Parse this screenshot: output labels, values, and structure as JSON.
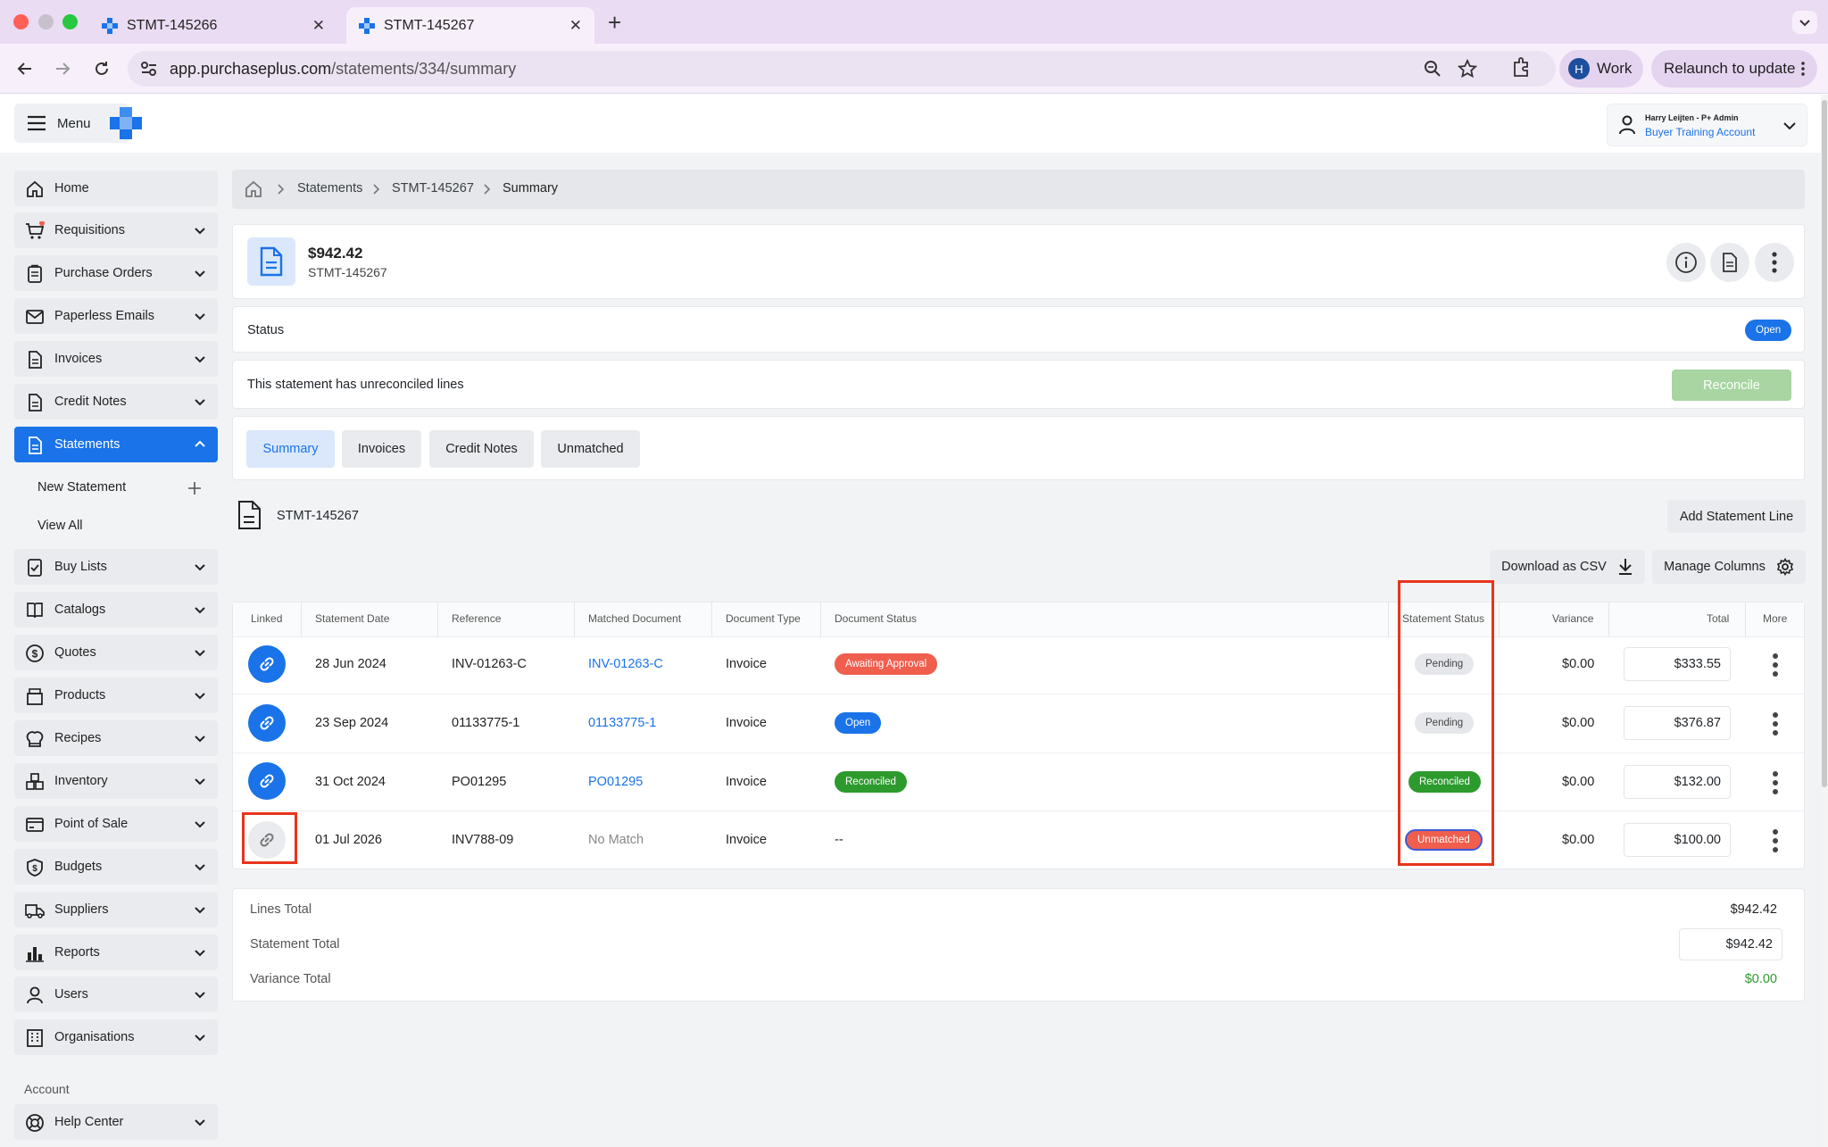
{
  "browser": {
    "tabs": [
      {
        "title": "STMT-145266",
        "active": false
      },
      {
        "title": "STMT-145267",
        "active": true
      }
    ],
    "url_host": "app.purchaseplus.com",
    "url_path": "/statements/334/summary",
    "profile_initial": "H",
    "profile_label": "Work",
    "relaunch_label": "Relaunch to update"
  },
  "header": {
    "menu_label": "Menu",
    "user_name": "Harry Leijten - P+ Admin",
    "user_account": "Buyer Training Account"
  },
  "sidebar": {
    "items": [
      {
        "label": "Home",
        "icon": "home-icon",
        "has_chevron": false
      },
      {
        "label": "Requisitions",
        "icon": "cart-icon",
        "has_chevron": true
      },
      {
        "label": "Purchase Orders",
        "icon": "clipboard-icon",
        "has_chevron": true
      },
      {
        "label": "Paperless Emails",
        "icon": "envelope-icon",
        "has_chevron": true
      },
      {
        "label": "Invoices",
        "icon": "document-icon",
        "has_chevron": true
      },
      {
        "label": "Credit Notes",
        "icon": "document-icon",
        "has_chevron": true
      },
      {
        "label": "Statements",
        "icon": "document-icon",
        "has_chevron": true,
        "active": true
      },
      {
        "label": "Buy Lists",
        "icon": "checklist-icon",
        "has_chevron": true
      },
      {
        "label": "Catalogs",
        "icon": "book-icon",
        "has_chevron": true
      },
      {
        "label": "Quotes",
        "icon": "dollar-icon",
        "has_chevron": true
      },
      {
        "label": "Products",
        "icon": "box-icon",
        "has_chevron": true
      },
      {
        "label": "Recipes",
        "icon": "chef-hat-icon",
        "has_chevron": true
      },
      {
        "label": "Inventory",
        "icon": "boxes-icon",
        "has_chevron": true
      },
      {
        "label": "Point of Sale",
        "icon": "card-icon",
        "has_chevron": true
      },
      {
        "label": "Budgets",
        "icon": "shield-dollar-icon",
        "has_chevron": true
      },
      {
        "label": "Suppliers",
        "icon": "truck-icon",
        "has_chevron": true
      },
      {
        "label": "Reports",
        "icon": "bar-chart-icon",
        "has_chevron": true
      },
      {
        "label": "Users",
        "icon": "user-icon",
        "has_chevron": true
      },
      {
        "label": "Organisations",
        "icon": "building-icon",
        "has_chevron": true
      }
    ],
    "sub_new": "New Statement",
    "sub_all": "View All",
    "account_section": "Account",
    "help": "Help Center"
  },
  "breadcrumb": {
    "items": [
      "Statements",
      "STMT-145267",
      "Summary"
    ]
  },
  "statement": {
    "amount": "$942.42",
    "number": "STMT-145267",
    "status_label": "Status",
    "status_value": "Open",
    "unreconciled_msg": "This statement has unreconciled lines",
    "reconcile_label": "Reconcile"
  },
  "tabs": [
    "Summary",
    "Invoices",
    "Credit Notes",
    "Unmatched"
  ],
  "lines_section": {
    "title": "STMT-145267",
    "add_line_label": "Add Statement Line",
    "download_label": "Download as CSV",
    "manage_columns_label": "Manage Columns"
  },
  "table": {
    "headers": [
      "Linked",
      "Statement Date",
      "Reference",
      "Matched Document",
      "Document Type",
      "Document Status",
      "Statement Status",
      "Variance",
      "Total",
      "More"
    ],
    "rows": [
      {
        "linked": true,
        "date": "28 Jun 2024",
        "reference": "INV-01263-C",
        "matched": "INV-01263-C",
        "type": "Invoice",
        "doc_status": "Awaiting Approval",
        "doc_status_kind": "await",
        "stmt_status": "Pending",
        "stmt_status_kind": "pending",
        "variance": "$0.00",
        "total": "$333.55"
      },
      {
        "linked": true,
        "date": "23 Sep 2024",
        "reference": "01133775-1",
        "matched": "01133775-1",
        "type": "Invoice",
        "doc_status": "Open",
        "doc_status_kind": "open",
        "stmt_status": "Pending",
        "stmt_status_kind": "pending",
        "variance": "$0.00",
        "total": "$376.87"
      },
      {
        "linked": true,
        "date": "31 Oct 2024",
        "reference": "PO01295",
        "matched": "PO01295",
        "type": "Invoice",
        "doc_status": "Reconciled",
        "doc_status_kind": "rec",
        "stmt_status": "Reconciled",
        "stmt_status_kind": "rec",
        "variance": "$0.00",
        "total": "$132.00"
      },
      {
        "linked": false,
        "date": "01 Jul 2026",
        "reference": "INV788-09",
        "matched": "No Match",
        "type": "Invoice",
        "doc_status": "--",
        "doc_status_kind": "none",
        "stmt_status": "Unmatched",
        "stmt_status_kind": "unmatched",
        "variance": "$0.00",
        "total": "$100.00"
      }
    ]
  },
  "totals": {
    "lines_label": "Lines Total",
    "lines_value": "$942.42",
    "statement_label": "Statement Total",
    "statement_value": "$942.42",
    "variance_label": "Variance Total",
    "variance_value": "$0.00"
  },
  "colors": {
    "accent": "#1a73e8",
    "danger": "#f05e4d",
    "success": "#2d9a2d",
    "highlight_box": "#e8341c"
  }
}
